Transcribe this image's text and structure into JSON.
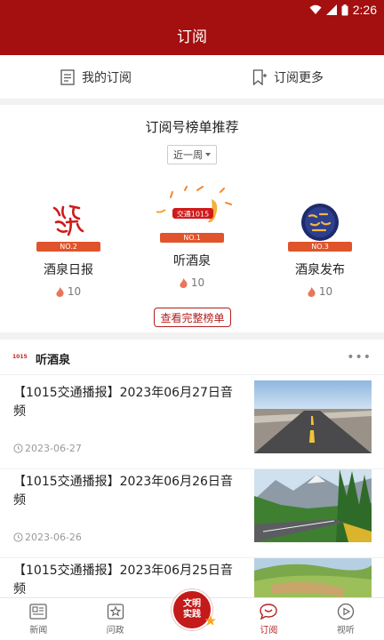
{
  "status": {
    "time": "2:26"
  },
  "header": {
    "title": "订阅"
  },
  "top_tabs": [
    {
      "label": "我的订阅",
      "icon": "document-icon"
    },
    {
      "label": "订阅更多",
      "icon": "bookmark-add-icon"
    }
  ],
  "ranking": {
    "title": "订阅号榜单推荐",
    "period": "近一周",
    "items": [
      {
        "badge": "NO.2",
        "name": "酒泉日报",
        "count": "10",
        "logo_text": "酒泉日报"
      },
      {
        "badge": "NO.1",
        "name": "听酒泉",
        "count": "10",
        "logo_text": "交通1015"
      },
      {
        "badge": "NO.3",
        "name": "酒泉发布",
        "count": "10",
        "logo_text": "酒泉发布"
      }
    ],
    "full_list_label": "查看完整榜单"
  },
  "channel": {
    "logo_text": "1015",
    "name": "听酒泉",
    "more_label": "•••",
    "articles": [
      {
        "title": "【1015交通播报】2023年06月27日音频",
        "date": "2023-06-27",
        "thumb": "road"
      },
      {
        "title": "【1015交通播报】2023年06月26日音频",
        "date": "2023-06-26",
        "thumb": "mountain-road"
      },
      {
        "title": "【1015交通播报】2023年06月25日音频",
        "date": "",
        "thumb": "hills"
      }
    ]
  },
  "bottom_nav": [
    {
      "label": "新闻",
      "icon": "newspaper-icon",
      "active": false
    },
    {
      "label": "问政",
      "icon": "star-box-icon",
      "active": false
    },
    {
      "label": "",
      "icon": "civilization-badge-icon",
      "active": false,
      "badge_text": "文明实践"
    },
    {
      "label": "订阅",
      "icon": "chat-bubble-icon",
      "active": true
    },
    {
      "label": "视听",
      "icon": "play-circle-icon",
      "active": false
    }
  ],
  "colors": {
    "brand": "#a40f0f",
    "accent": "#b51f1f",
    "badge_orange": "#e0542b"
  }
}
